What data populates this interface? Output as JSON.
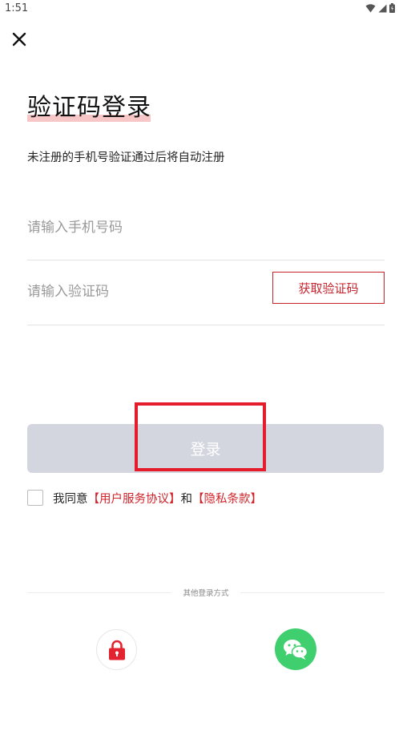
{
  "status_bar": {
    "time": "1:51"
  },
  "header": {
    "close_icon": "close-icon"
  },
  "page": {
    "title": "验证码登录",
    "subtitle": "未注册的手机号验证通过后将自动注册"
  },
  "form": {
    "phone_placeholder": "请输入手机号码",
    "phone_value": "",
    "code_placeholder": "请输入验证码",
    "code_value": "",
    "get_code_label": "获取验证码",
    "login_label": "登录"
  },
  "agreement": {
    "checked": false,
    "prefix": "我同意",
    "user_agreement": "【用户服务协议】",
    "conjunction": "和",
    "privacy_policy": "【隐私条款】"
  },
  "other_login": {
    "label": "其他登录方式",
    "methods": [
      "lock-icon",
      "wechat-icon"
    ]
  },
  "colors": {
    "accent_red": "#c9232d",
    "login_disabled": "#d3d6de",
    "wechat_green": "#3fcf6e",
    "highlight": "#f7c7c7"
  }
}
